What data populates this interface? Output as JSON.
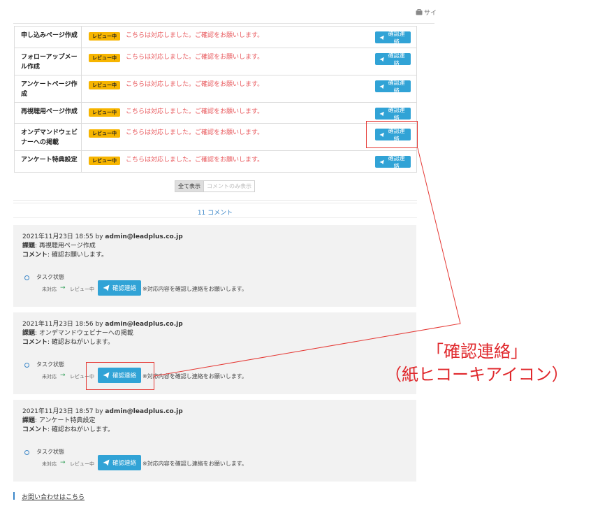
{
  "topbar": {
    "site_label": "サイ",
    "icon": "briefcase-icon"
  },
  "tasks": [
    {
      "name": "申し込みページ作成",
      "status": "レビュー中",
      "message": "こちらは対応しました。ご確認をお願いします。",
      "button": "確認連絡"
    },
    {
      "name": "フォローアップメール作成",
      "status": "レビュー中",
      "message": "こちらは対応しました。ご確認をお願いします。",
      "button": "確認連絡"
    },
    {
      "name": "アンケートページ作成",
      "status": "レビュー中",
      "message": "こちらは対応しました。ご確認をお願いします。",
      "button": "確認連絡"
    },
    {
      "name": "再視聴用ページ作成",
      "status": "レビュー中",
      "message": "こちらは対応しました。ご確認をお願いします。",
      "button": "確認連絡"
    },
    {
      "name": "オンデマンドウェビナーへの掲載",
      "status": "レビュー中",
      "message": "こちらは対応しました。ご確認をお願いします。",
      "button": "確認連絡"
    },
    {
      "name": "アンケート特典設定",
      "status": "レビュー中",
      "message": "こちらは対応しました。ご確認をお願いします。",
      "button": "確認連絡"
    }
  ],
  "toggle": {
    "all": "全て表示",
    "comments_only": "コメントのみ表示"
  },
  "comments_count": "11 コメント",
  "comments": [
    {
      "datetime": "2021年11月23日 18:55",
      "by": "by",
      "author": "admin@leadplus.co.jp",
      "subject_label": "課題",
      "subject": ": 再視聴用ページ作成",
      "comment_label": "コメント",
      "comment": ": 確認お願いします。",
      "status_title": "タスク状態",
      "from": "未対応",
      "arrow": "→",
      "to": "レビュー中",
      "button": "確認連絡",
      "note": "※対応内容を確認し連絡をお願いします。"
    },
    {
      "datetime": "2021年11月23日 18:56",
      "by": "by",
      "author": "admin@leadplus.co.jp",
      "subject_label": "課題",
      "subject": ": オンデマンドウェビナーへの掲載",
      "comment_label": "コメント",
      "comment": ": 確認おねがいします。",
      "status_title": "タスク状態",
      "from": "未対応",
      "arrow": "→",
      "to": "レビュー中",
      "button": "確認連絡",
      "note": "※対応内容を確認し連絡をお願いします。"
    },
    {
      "datetime": "2021年11月23日 18:57",
      "by": "by",
      "author": "admin@leadplus.co.jp",
      "subject_label": "課題",
      "subject": ": アンケート特典設定",
      "comment_label": "コメント",
      "comment": ": 確認おねがいします。",
      "status_title": "タスク状態",
      "from": "未対応",
      "arrow": "→",
      "to": "レビュー中",
      "button": "確認連絡",
      "note": "※対応内容を確認し連絡をお願いします。"
    }
  ],
  "footer": {
    "contact_link": "お問い合わせはこちら"
  },
  "annotation": {
    "line1": "「確認連絡」",
    "line2": "（紙ヒコーキアイコン）"
  },
  "colors": {
    "accent": "#31a3d6",
    "badge": "#f7b500",
    "message": "#e8585c",
    "annotation": "#e0282c",
    "link": "#3a86c8"
  }
}
